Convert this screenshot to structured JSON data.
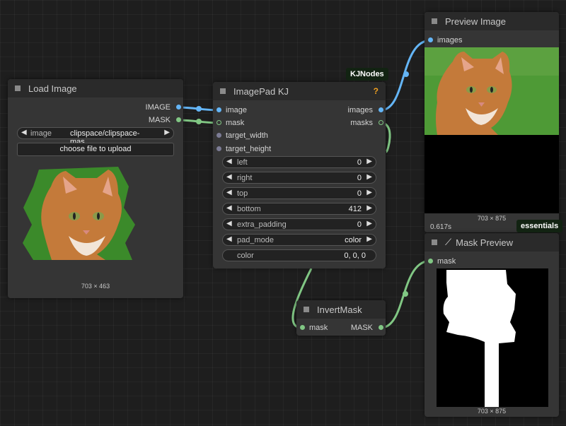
{
  "colors": {
    "image_link": "#64b5f6",
    "mask_link": "#81c784",
    "node_bg": "#353535",
    "header_bg": "#2a2a2a",
    "canvas_bg": "#1e1e1e"
  },
  "load_image": {
    "title": "Load Image",
    "outputs": [
      "IMAGE",
      "MASK"
    ],
    "image_label": "image",
    "image_value": "clipspace/clipspace-mas...",
    "upload_label": "choose file to upload",
    "dims": "703 × 463"
  },
  "imagepad": {
    "title": "ImagePad KJ",
    "help_icon": "?",
    "badge": "KJNodes",
    "inputs": [
      "image",
      "mask",
      "target_width",
      "target_height"
    ],
    "outputs": [
      "images",
      "masks"
    ],
    "widgets": [
      {
        "label": "left",
        "value": "0"
      },
      {
        "label": "right",
        "value": "0"
      },
      {
        "label": "top",
        "value": "0"
      },
      {
        "label": "bottom",
        "value": "412"
      },
      {
        "label": "extra_padding",
        "value": "0"
      },
      {
        "label": "pad_mode",
        "value": "color"
      },
      {
        "label": "color",
        "value": "0, 0, 0"
      }
    ]
  },
  "preview_image": {
    "title": "Preview Image",
    "input": "images",
    "dims": "703 × 875",
    "exec_time": "0.617s",
    "badge": "essentials"
  },
  "invert_mask": {
    "title": "InvertMask",
    "input": "mask",
    "output": "MASK"
  },
  "mask_preview": {
    "title": "Mask Preview",
    "icon": "wand-icon",
    "input": "mask",
    "dims": "703 × 875"
  }
}
